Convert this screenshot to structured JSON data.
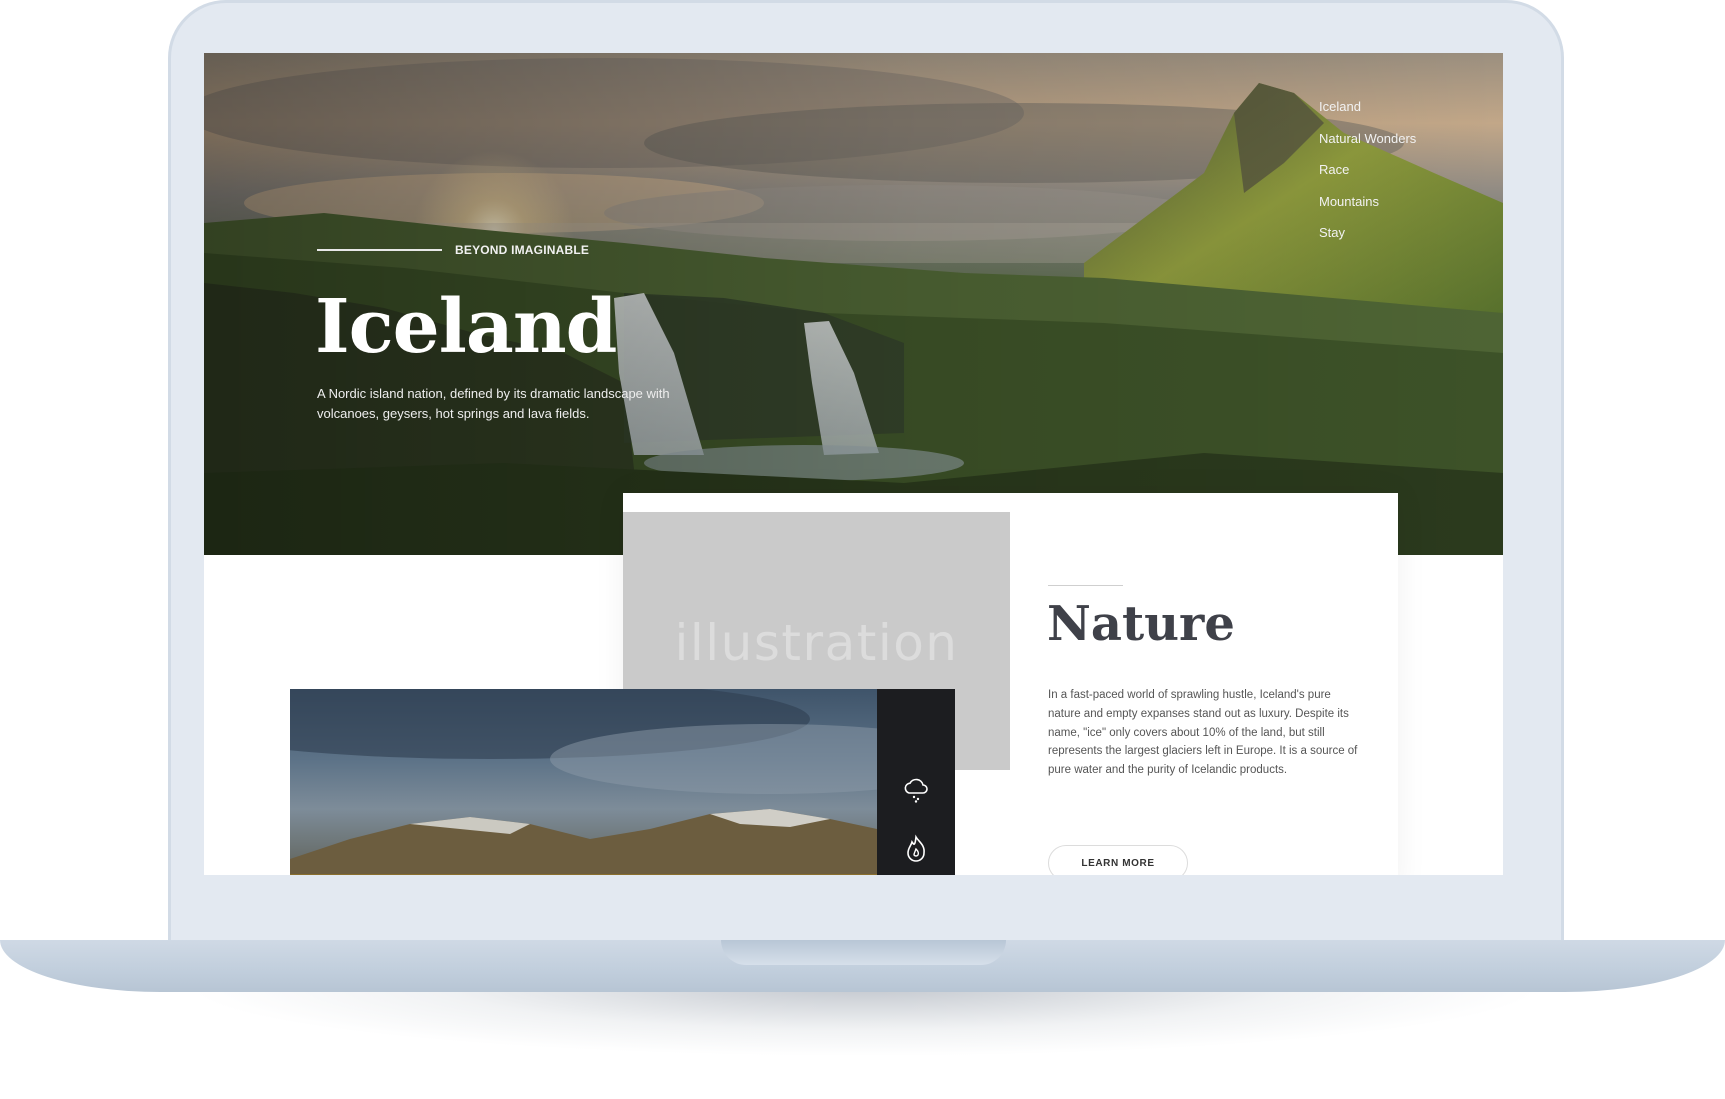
{
  "hero": {
    "tagline": "BEYOND IMAGINABLE",
    "title": "Iceland",
    "description": "A Nordic island nation, defined by its dramatic landscape with volcanoes, geysers, hot springs and lava fields."
  },
  "nav": {
    "items": [
      "Iceland",
      "Natural Wonders",
      "Race",
      "Mountains",
      "Stay"
    ]
  },
  "nature": {
    "illustration_label": "illustration",
    "title": "Nature",
    "text": "In a fast-paced world of sprawling hustle, Iceland's pure nature and empty expanses stand out as luxury. Despite its name, \"ice\" only covers about 10% of the land, but still represents the largest glaciers left in Europe. It is a source of pure water and the purity of Icelandic products.",
    "button_label": "LEARN MORE"
  },
  "side_icons": [
    "cloud-snow-icon",
    "fire-icon"
  ],
  "colors": {
    "laptop_frame": "#e3e9f1",
    "heading_dark": "#3f4149",
    "sidebar_dark": "#1c1d20",
    "placeholder_gray": "#cacaca"
  }
}
